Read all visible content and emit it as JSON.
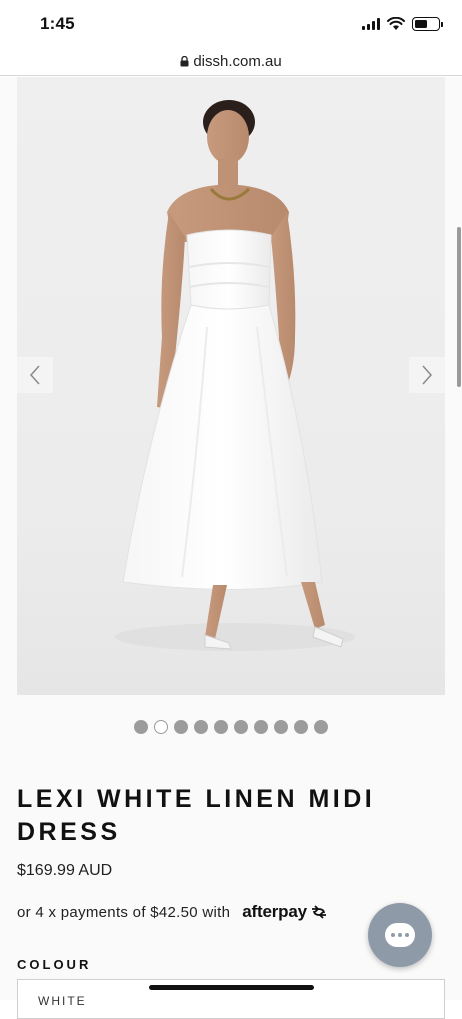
{
  "status_bar": {
    "time": "1:45"
  },
  "browser": {
    "url": "dissh.com.au"
  },
  "gallery": {
    "prev_icon": "chevron-left-icon",
    "next_icon": "chevron-right-icon",
    "image_description_icon": "product-photo",
    "dot_count": 10,
    "active_dot": 2
  },
  "product": {
    "title": "LEXI WHITE LINEN MIDI DRESS",
    "price": "$169.99 AUD",
    "afterpay_text": "or 4 x payments of $42.50 with",
    "afterpay_brand": "afterpay"
  },
  "colour": {
    "label": "COLOUR",
    "selected": "WHITE"
  },
  "colors": {
    "chat_button": "#8f9aa9",
    "dot_inactive": "#9c9c9c"
  }
}
